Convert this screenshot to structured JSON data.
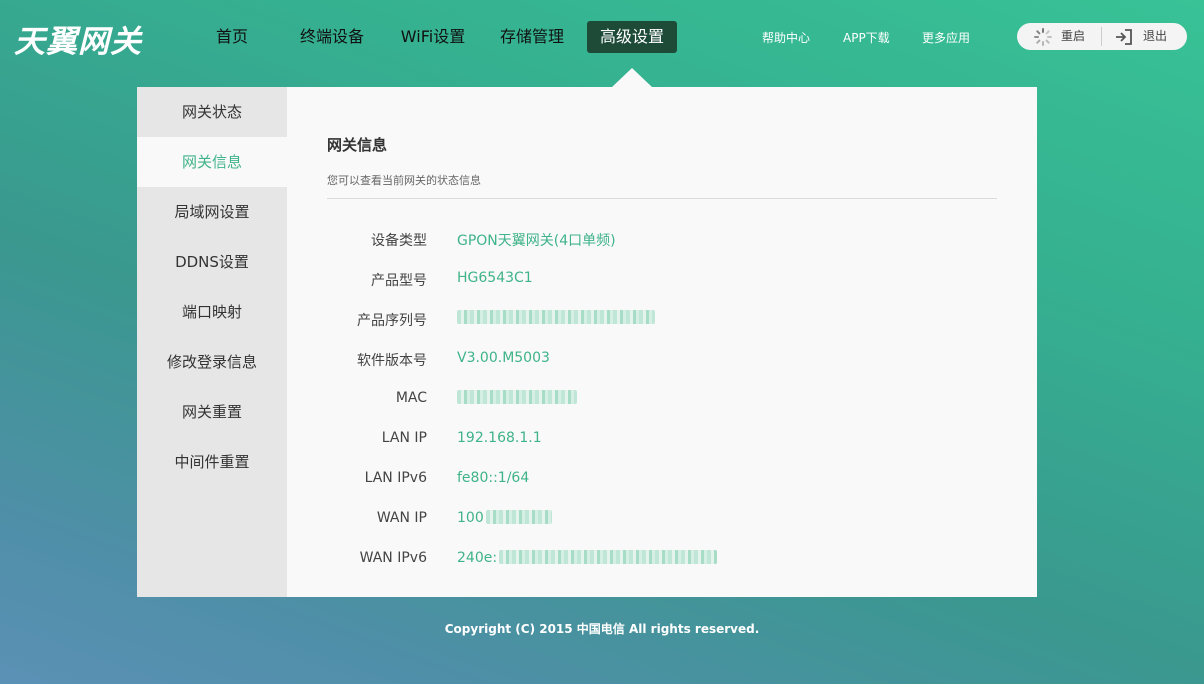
{
  "header": {
    "logo_text": "天翼网关",
    "nav": [
      {
        "label": "首页"
      },
      {
        "label": "终端设备"
      },
      {
        "label": "WiFi设置"
      },
      {
        "label": "存储管理"
      },
      {
        "label": "高级设置",
        "active": true
      }
    ],
    "links": [
      {
        "label": "帮助中心"
      },
      {
        "label": "APP下载"
      },
      {
        "label": "更多应用"
      }
    ],
    "restart_label": "重启",
    "logout_label": "退出",
    "restart_icon": "spinner-icon",
    "logout_icon": "logout-icon"
  },
  "sidebar": {
    "items": [
      {
        "label": "网关状态"
      },
      {
        "label": "网关信息",
        "active": true
      },
      {
        "label": "局域网设置"
      },
      {
        "label": "DDNS设置"
      },
      {
        "label": "端口映射"
      },
      {
        "label": "修改登录信息"
      },
      {
        "label": "网关重置"
      },
      {
        "label": "中间件重置"
      }
    ]
  },
  "content": {
    "title": "网关信息",
    "subtitle": "您可以查看当前网关的状态信息",
    "rows": [
      {
        "label": "设备类型",
        "value": "GPON天翼网关(4口单频)"
      },
      {
        "label": "产品型号",
        "value": "HG6543C1"
      },
      {
        "label": "产品序列号",
        "value": ""
      },
      {
        "label": "软件版本号",
        "value": "V3.00.M5003"
      },
      {
        "label": "MAC",
        "value": ""
      },
      {
        "label": "LAN IP",
        "value": "192.168.1.1"
      },
      {
        "label": "LAN IPv6",
        "value": "fe80::1/64"
      },
      {
        "label": "WAN IP",
        "value": "100"
      },
      {
        "label": "WAN IPv6",
        "value": "240e:"
      }
    ]
  },
  "footer": {
    "copyright": "Copyright (C) 2015 中国电信 All rights reserved."
  },
  "colors": {
    "accent": "#3fb38a",
    "nav_active_bg": "#1e4a38",
    "panel_bg": "#f9f9f9",
    "sidebar_bg": "#e6e6e6"
  }
}
